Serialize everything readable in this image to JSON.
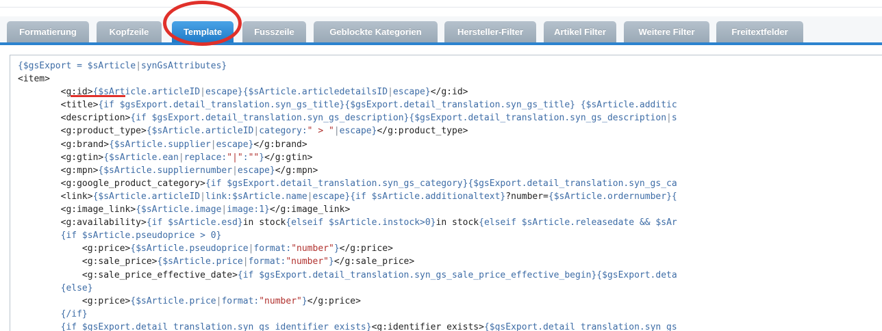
{
  "tabs": [
    {
      "label": "Formatierung",
      "active": false
    },
    {
      "label": "Kopfzeile",
      "active": false
    },
    {
      "label": "Template",
      "active": true
    },
    {
      "label": "Fusszeile",
      "active": false
    },
    {
      "label": "Geblockte Kategorien",
      "active": false
    },
    {
      "label": "Hersteller-Filter",
      "active": false
    },
    {
      "label": "Artikel Filter",
      "active": false
    },
    {
      "label": "Weitere Filter",
      "active": false
    },
    {
      "label": "Freitextfelder",
      "active": false
    }
  ],
  "colors": {
    "tab_active": "#2c83cf",
    "tab_inactive": "#a8b6c2",
    "annotation": "#e0302a",
    "template_var": "#3d6ca6",
    "string_literal": "#b0302d"
  },
  "editor": {
    "lines": [
      [
        [
          "s",
          "{$gsExport = $sArticle"
        ],
        [
          "m",
          "|"
        ],
        [
          "s",
          "synGsAttributes}"
        ]
      ],
      [
        [
          "t",
          "<item>"
        ]
      ],
      [
        [
          "t",
          "        <g:id>"
        ],
        [
          "s",
          "{$sArticle.articleID"
        ],
        [
          "m",
          "|"
        ],
        [
          "s",
          "escape}{$sArticle.articledetailsID"
        ],
        [
          "m",
          "|"
        ],
        [
          "s",
          "escape}"
        ],
        [
          "t",
          "</g:id>"
        ]
      ],
      [
        [
          "t",
          "        <title>"
        ],
        [
          "s",
          "{if $gsExport.detail_translation.syn_gs_title}{$gsExport.detail_translation.syn_gs_title} {$sArticle.additic"
        ]
      ],
      [
        [
          "t",
          "        <description>"
        ],
        [
          "s",
          "{if $gsExport.detail_translation.syn_gs_description}{$gsExport.detail_translation.syn_gs_description"
        ],
        [
          "m",
          "|"
        ],
        [
          "s",
          "s"
        ]
      ],
      [
        [
          "t",
          "        <g:product_type>"
        ],
        [
          "s",
          "{$sArticle.articleID"
        ],
        [
          "m",
          "|"
        ],
        [
          "s",
          "category:"
        ],
        [
          "k",
          "\" > \""
        ],
        [
          "m",
          "|"
        ],
        [
          "s",
          "escape}"
        ],
        [
          "t",
          "</g:product_type>"
        ]
      ],
      [
        [
          "t",
          "        <g:brand>"
        ],
        [
          "s",
          "{$sArticle.supplier"
        ],
        [
          "m",
          "|"
        ],
        [
          "s",
          "escape}"
        ],
        [
          "t",
          "</g:brand>"
        ]
      ],
      [
        [
          "t",
          "        <g:gtin>"
        ],
        [
          "s",
          "{$sArticle.ean"
        ],
        [
          "m",
          "|"
        ],
        [
          "s",
          "replace:"
        ],
        [
          "k",
          "\"|\""
        ],
        [
          "s",
          ":"
        ],
        [
          "k",
          "\"\""
        ],
        [
          "s",
          "}"
        ],
        [
          "t",
          "</g:gtin>"
        ]
      ],
      [
        [
          "t",
          "        <g:mpn>"
        ],
        [
          "s",
          "{$sArticle.suppliernumber"
        ],
        [
          "m",
          "|"
        ],
        [
          "s",
          "escape}"
        ],
        [
          "t",
          "</g:mpn>"
        ]
      ],
      [
        [
          "t",
          "        <g:google_product_category>"
        ],
        [
          "s",
          "{if $gsExport.detail_translation.syn_gs_category}{$gsExport.detail_translation.syn_gs_ca"
        ]
      ],
      [
        [
          "t",
          "        <link>"
        ],
        [
          "s",
          "{$sArticle.articleID"
        ],
        [
          "m",
          "|"
        ],
        [
          "s",
          "link:$sArticle.name"
        ],
        [
          "m",
          "|"
        ],
        [
          "s",
          "escape}{if $sArticle.additionaltext}"
        ],
        [
          "t",
          "?number="
        ],
        [
          "s",
          "{$sArticle.ordernumber}{"
        ]
      ],
      [
        [
          "t",
          "        <g:image_link>"
        ],
        [
          "s",
          "{$sArticle.image"
        ],
        [
          "m",
          "|"
        ],
        [
          "s",
          "image:1}"
        ],
        [
          "t",
          "</g:image_link>"
        ]
      ],
      [
        [
          "t",
          "        <g:availability>"
        ],
        [
          "s",
          "{if $sArticle.esd}"
        ],
        [
          "t",
          "in stock"
        ],
        [
          "s",
          "{elseif $sArticle.instock>0}"
        ],
        [
          "t",
          "in stock"
        ],
        [
          "s",
          "{elseif $sArticle.releasedate && $sAr"
        ]
      ],
      [
        [
          "s",
          "        {if $sArticle.pseudoprice > 0}"
        ]
      ],
      [
        [
          "t",
          "            <g:price>"
        ],
        [
          "s",
          "{$sArticle.pseudoprice"
        ],
        [
          "m",
          "|"
        ],
        [
          "s",
          "format:"
        ],
        [
          "k",
          "\"number\""
        ],
        [
          "s",
          "}"
        ],
        [
          "t",
          "</g:price>"
        ]
      ],
      [
        [
          "t",
          "            <g:sale_price>"
        ],
        [
          "s",
          "{$sArticle.price"
        ],
        [
          "m",
          "|"
        ],
        [
          "s",
          "format:"
        ],
        [
          "k",
          "\"number\""
        ],
        [
          "s",
          "}"
        ],
        [
          "t",
          "</g:sale_price>"
        ]
      ],
      [
        [
          "t",
          "            <g:sale_price_effective_date>"
        ],
        [
          "s",
          "{if $gsExport.detail_translation.syn_gs_sale_price_effective_begin}{$gsExport.deta"
        ]
      ],
      [
        [
          "s",
          "        {else}"
        ]
      ],
      [
        [
          "t",
          "            <g:price>"
        ],
        [
          "s",
          "{$sArticle.price"
        ],
        [
          "m",
          "|"
        ],
        [
          "s",
          "format:"
        ],
        [
          "k",
          "\"number\""
        ],
        [
          "s",
          "}"
        ],
        [
          "t",
          "</g:price>"
        ]
      ],
      [
        [
          "s",
          "        {/if}"
        ]
      ],
      [
        [
          "s",
          "        {if $gsExport.detail_translation.syn_gs_identifier_exists}"
        ],
        [
          "t",
          "<g:identifier_exists>"
        ],
        [
          "s",
          "{$gsExport.detail_translation.syn_gs"
        ]
      ]
    ]
  }
}
